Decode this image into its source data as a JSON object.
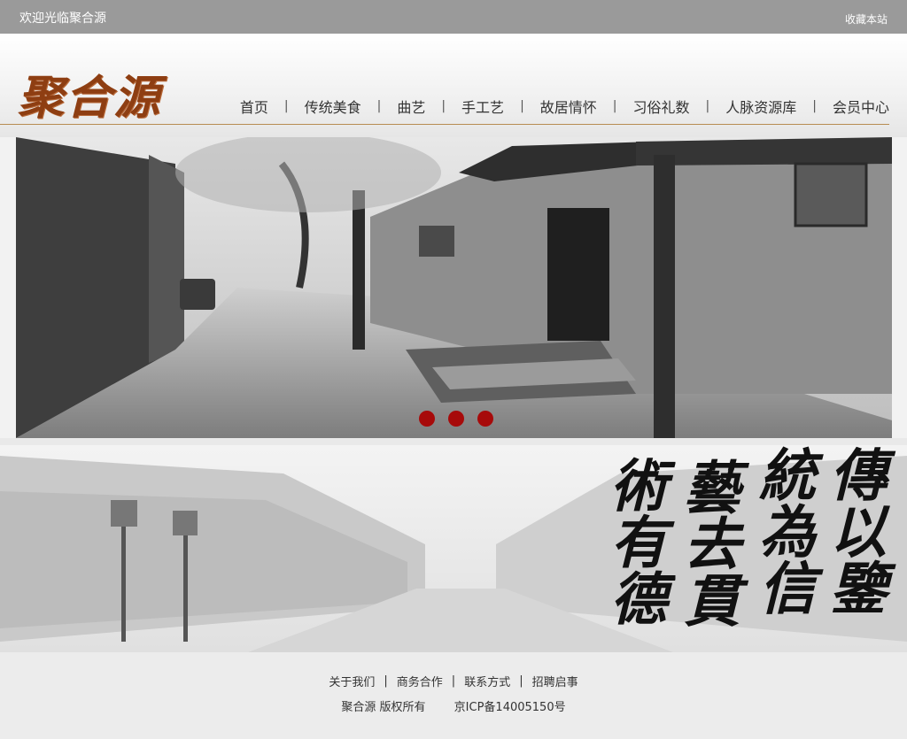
{
  "topbar": {
    "welcome": "欢迎光临聚合源",
    "favorite": "收藏本站"
  },
  "logo": {
    "text": "聚合源"
  },
  "nav": {
    "items": [
      "首页",
      "传统美食",
      "曲艺",
      "手工艺",
      "故居情怀",
      "习俗礼数",
      "人脉资源库",
      "会员中心"
    ],
    "separator": "|"
  },
  "banner": {
    "slides": 3,
    "active": 1,
    "dot_color": "#a70a0a"
  },
  "calligraphy": {
    "col1": "傳以鑒",
    "col2": "統為信",
    "col3": "藝去貫",
    "col4": "術有德"
  },
  "footer": {
    "links": [
      "关于我们",
      "商务合作",
      "联系方式",
      "招聘启事"
    ],
    "separator": "|",
    "copyright": "聚合源 版权所有",
    "icp": "京ICP备14005150号"
  },
  "colors": {
    "topbar": "#9a9a9a",
    "logo": "#8e3e12",
    "rule": "#b78c52"
  }
}
